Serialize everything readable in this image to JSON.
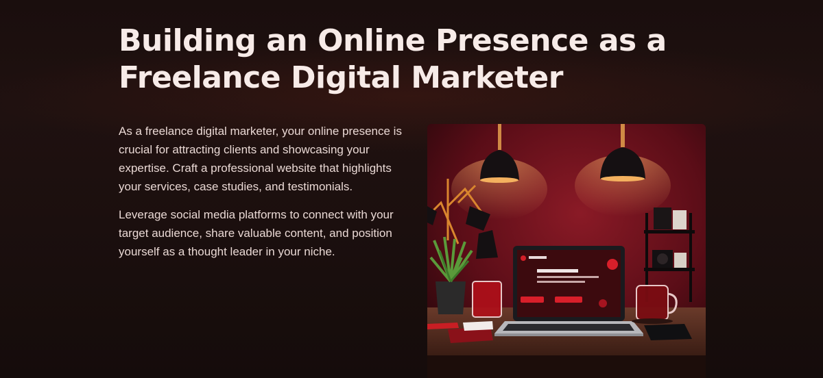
{
  "slide": {
    "title_line1": "Building an Online Presence as a",
    "title_line2": "Freelance Digital Marketer",
    "paragraphs": [
      "As a freelance digital marketer, your online presence is crucial for attracting clients and showcasing your expertise. Craft a professional website that highlights your services, case studies, and testimonials.",
      "Leverage social media platforms to connect with your target audience, share valuable content, and position yourself as a thought leader in your niche."
    ]
  },
  "colors": {
    "background": "#1b0f0e",
    "title_text": "#f7ebe8",
    "body_text": "#ead9d5",
    "accent_red": "#c4161c"
  }
}
